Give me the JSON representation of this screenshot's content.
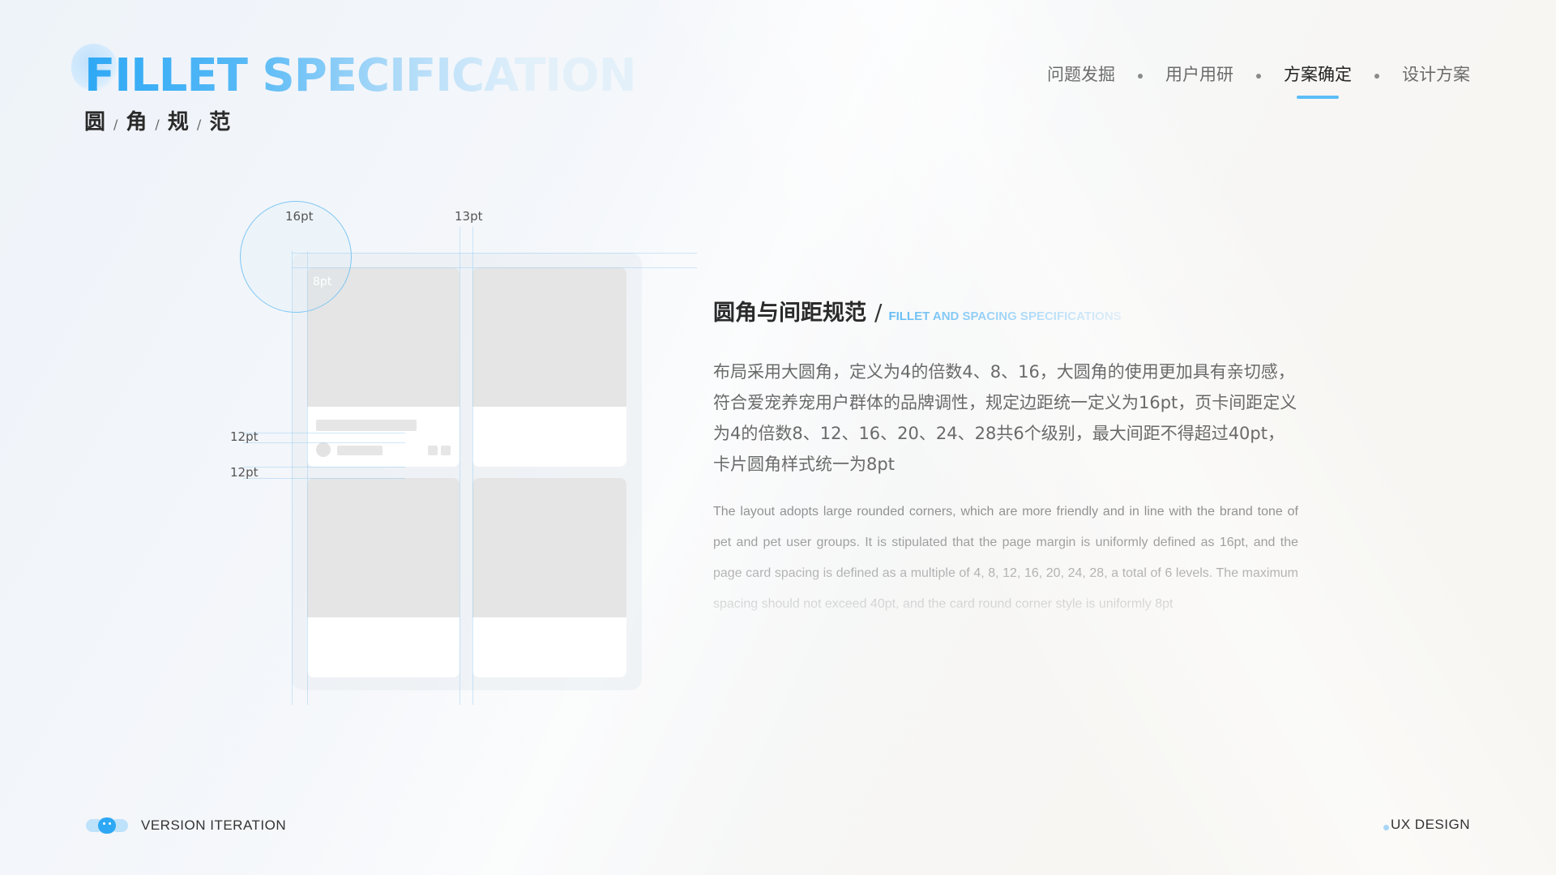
{
  "header": {
    "title_en": "FILLET SPECIFICATION",
    "title_zh": [
      "圆",
      "角",
      "规",
      "范"
    ],
    "title_zh_sep": "/"
  },
  "nav": {
    "items": [
      {
        "label": "问题发掘",
        "active": false
      },
      {
        "label": "用户用研",
        "active": false
      },
      {
        "label": "方案确定",
        "active": true
      },
      {
        "label": "设计方案",
        "active": false
      }
    ]
  },
  "diagram": {
    "labels": {
      "corner_outer": "16pt",
      "gap_top": "13pt",
      "corner_inner": "8pt",
      "spacing_a": "12pt",
      "spacing_b": "12pt"
    }
  },
  "section": {
    "title_zh": "圆角与间距规范",
    "slash": "/",
    "title_en": "FILLET AND SPACING SPECIFICATIONS",
    "body_zh": "布局采用大圆角，定义为4的倍数4、8、16，大圆角的使用更加具有亲切感，符合爱宠养宠用户群体的品牌调性，规定边距统一定义为16pt，页卡间距定义为4的倍数8、12、16、20、24、28共6个级别，最大间距不得超过40pt，卡片圆角样式统一为8pt",
    "body_en": "The layout adopts large rounded corners, which are more friendly and in line with the brand tone of pet and pet user groups. It is stipulated that the page margin is uniformly defined as 16pt, and the page card spacing is defined as a multiple of 4, 8, 12, 16, 20, 24, 28, a total of 6 levels. The maximum spacing should not exceed 40pt, and the card round corner style is uniformly 8pt"
  },
  "footer": {
    "left_text": "VERSION ITERATION",
    "right_text": "UX DESIGN"
  },
  "colors": {
    "accent": "#2ea8f5",
    "accent_light": "#5cbdf7",
    "background": "#f3f6f9"
  }
}
